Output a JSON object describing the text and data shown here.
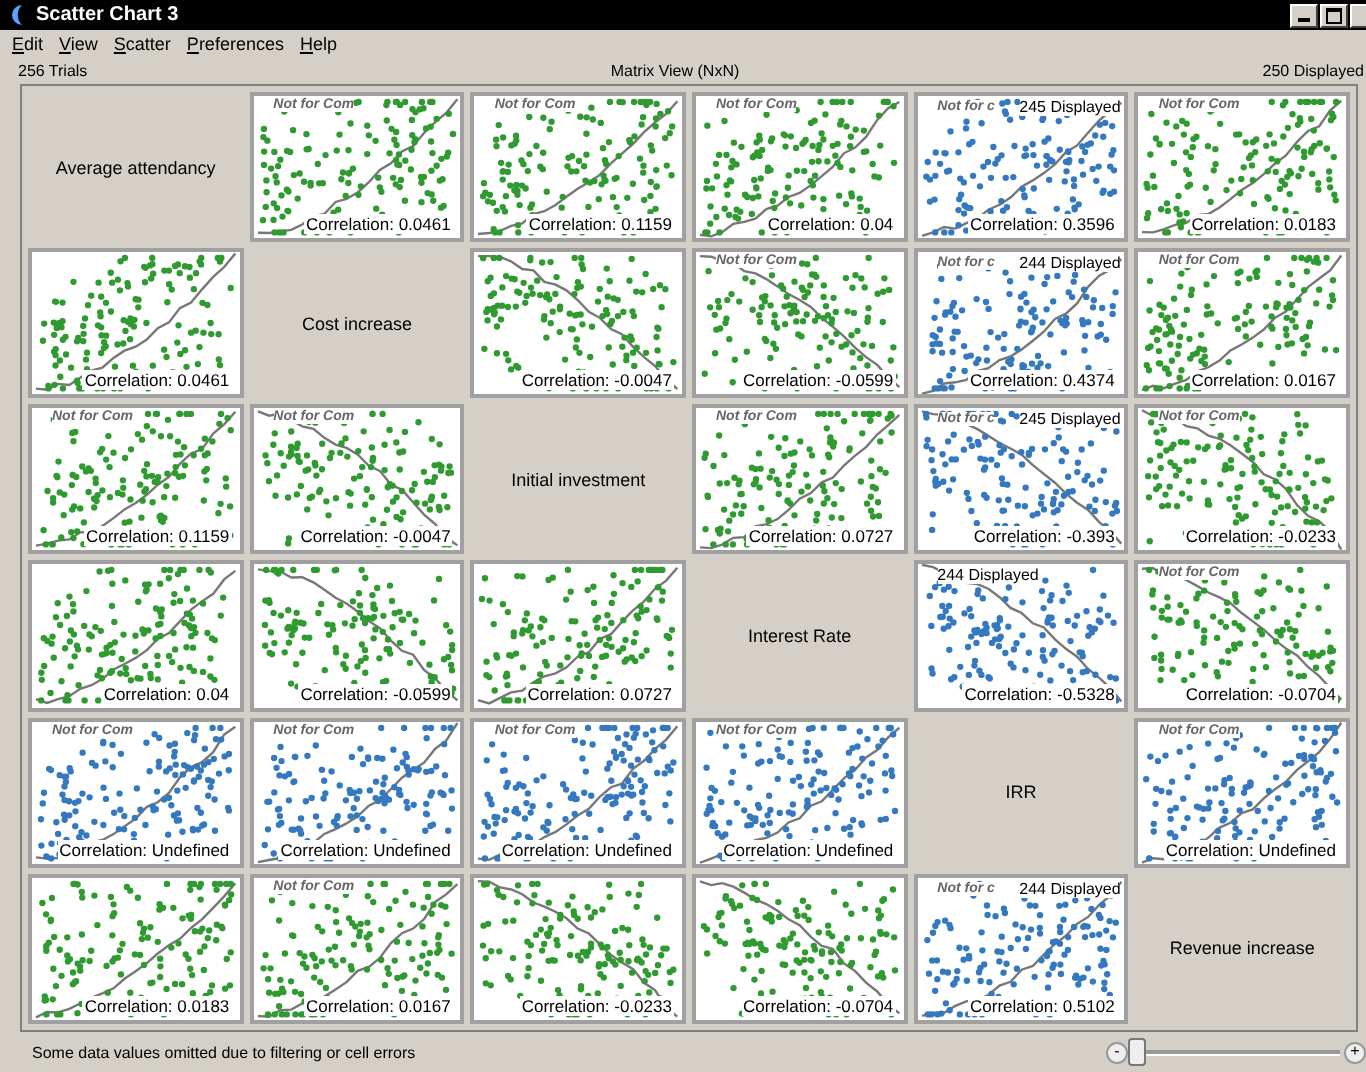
{
  "window": {
    "title": "Scatter Chart 3"
  },
  "menu": [
    "Edit",
    "View",
    "Scatter",
    "Preferences",
    "Help"
  ],
  "info": {
    "trials": "256 Trials",
    "view": "Matrix View (NxN)",
    "displayed": "250 Displayed"
  },
  "rows": [
    {
      "cells": [
        {
          "kind": "label",
          "text": "Average attendancy"
        },
        {
          "kind": "plot",
          "color": "#2f9a2f",
          "watermark": "Not for Com",
          "correlation": "Correlation: 0.0461"
        },
        {
          "kind": "plot",
          "color": "#2f9a2f",
          "watermark": "Not for Com",
          "correlation": "Correlation: 0.1159"
        },
        {
          "kind": "plot",
          "color": "#2f9a2f",
          "watermark": "Not for Com",
          "correlation": "Correlation: 0.04"
        },
        {
          "kind": "plot",
          "color": "#3478c0",
          "watermark": "Not for c",
          "shown": "245 Displayed",
          "correlation": "Correlation: 0.3596"
        },
        {
          "kind": "plot",
          "color": "#2f9a2f",
          "watermark": "Not for Com",
          "correlation": "Correlation: 0.0183"
        }
      ]
    },
    {
      "cells": [
        {
          "kind": "plot",
          "color": "#2f9a2f",
          "correlation": "Correlation: 0.0461"
        },
        {
          "kind": "label",
          "text": "Cost increase"
        },
        {
          "kind": "plot",
          "color": "#2f9a2f",
          "correlation": "Correlation: -0.0047"
        },
        {
          "kind": "plot",
          "color": "#2f9a2f",
          "watermark": "Not for Com",
          "correlation": "Correlation: -0.0599"
        },
        {
          "kind": "plot",
          "color": "#3478c0",
          "watermark": "Not for c",
          "shown": "244 Displayed",
          "correlation": "Correlation: 0.4374"
        },
        {
          "kind": "plot",
          "color": "#2f9a2f",
          "watermark": "Not for Com",
          "correlation": "Correlation: 0.0167"
        }
      ]
    },
    {
      "cells": [
        {
          "kind": "plot",
          "color": "#2f9a2f",
          "watermark": "Not for Com",
          "correlation": "Correlation: 0.1159"
        },
        {
          "kind": "plot",
          "color": "#2f9a2f",
          "watermark": "Not for Com",
          "correlation": "Correlation: -0.0047"
        },
        {
          "kind": "label",
          "text": "Initial investment"
        },
        {
          "kind": "plot",
          "color": "#2f9a2f",
          "watermark": "Not for Com",
          "correlation": "Correlation: 0.0727"
        },
        {
          "kind": "plot",
          "color": "#3478c0",
          "watermark": "Not for c",
          "shown": "245 Displayed",
          "correlation": "Correlation: -0.393"
        },
        {
          "kind": "plot",
          "color": "#2f9a2f",
          "watermark": "Not for Com",
          "correlation": "Correlation: -0.0233"
        }
      ]
    },
    {
      "cells": [
        {
          "kind": "plot",
          "color": "#2f9a2f",
          "correlation": "Correlation: 0.04"
        },
        {
          "kind": "plot",
          "color": "#2f9a2f",
          "correlation": "Correlation: -0.0599"
        },
        {
          "kind": "plot",
          "color": "#2f9a2f",
          "correlation": "Correlation: 0.0727"
        },
        {
          "kind": "label",
          "text": "Interest Rate"
        },
        {
          "kind": "plot",
          "color": "#3478c0",
          "shown": "244 Displayed",
          "correlation": "Correlation: -0.5328"
        },
        {
          "kind": "plot",
          "color": "#2f9a2f",
          "watermark": "Not for Com",
          "correlation": "Correlation: -0.0704"
        }
      ]
    },
    {
      "cells": [
        {
          "kind": "plot",
          "color": "#3478c0",
          "watermark": "Not for Com",
          "correlation": "Correlation: Undefined"
        },
        {
          "kind": "plot",
          "color": "#3478c0",
          "watermark": "Not for Com",
          "correlation": "Correlation: Undefined"
        },
        {
          "kind": "plot",
          "color": "#3478c0",
          "watermark": "Not for Com",
          "correlation": "Correlation: Undefined"
        },
        {
          "kind": "plot",
          "color": "#3478c0",
          "watermark": "Not for Com",
          "correlation": "Correlation: Undefined"
        },
        {
          "kind": "label",
          "text": "IRR"
        },
        {
          "kind": "plot",
          "color": "#3478c0",
          "watermark": "Not for Com",
          "correlation": "Correlation: Undefined"
        }
      ]
    },
    {
      "cells": [
        {
          "kind": "plot",
          "color": "#2f9a2f",
          "correlation": "Correlation: 0.0183"
        },
        {
          "kind": "plot",
          "color": "#2f9a2f",
          "watermark": "Not for Com",
          "correlation": "Correlation: 0.0167"
        },
        {
          "kind": "plot",
          "color": "#2f9a2f",
          "correlation": "Correlation: -0.0233"
        },
        {
          "kind": "plot",
          "color": "#2f9a2f",
          "correlation": "Correlation: -0.0704"
        },
        {
          "kind": "plot",
          "color": "#3478c0",
          "watermark": "Not for c",
          "shown": "244 Displayed",
          "correlation": "Correlation: 0.5102"
        },
        {
          "kind": "label",
          "text": "Revenue increase"
        }
      ]
    }
  ],
  "status": {
    "message": "Some data values omitted due to filtering or cell errors",
    "zoom_out": "-",
    "zoom_in": "+",
    "zoom": {
      "level": 0.02
    }
  }
}
